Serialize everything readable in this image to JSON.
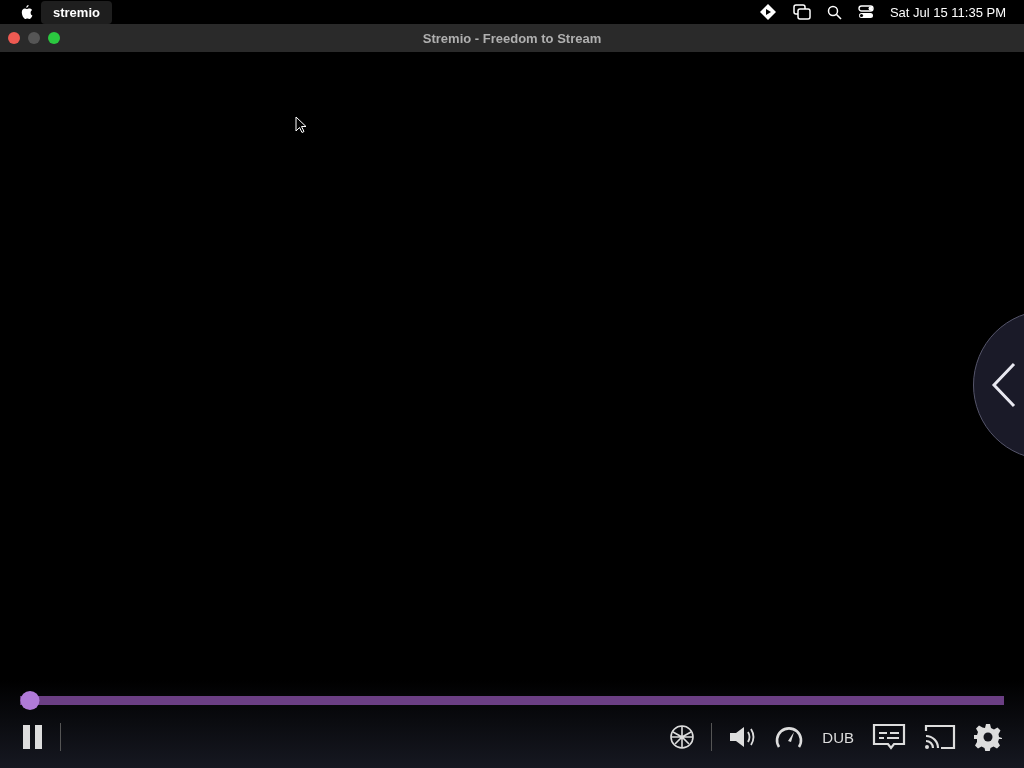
{
  "menu_bar": {
    "app_name": "stremio",
    "clock": "Sat Jul 15  11:35 PM"
  },
  "window": {
    "title": "Stremio - Freedom to Stream"
  },
  "player": {
    "seek": {
      "level": 0.01
    },
    "playing": true,
    "audio_track": "DUB"
  }
}
